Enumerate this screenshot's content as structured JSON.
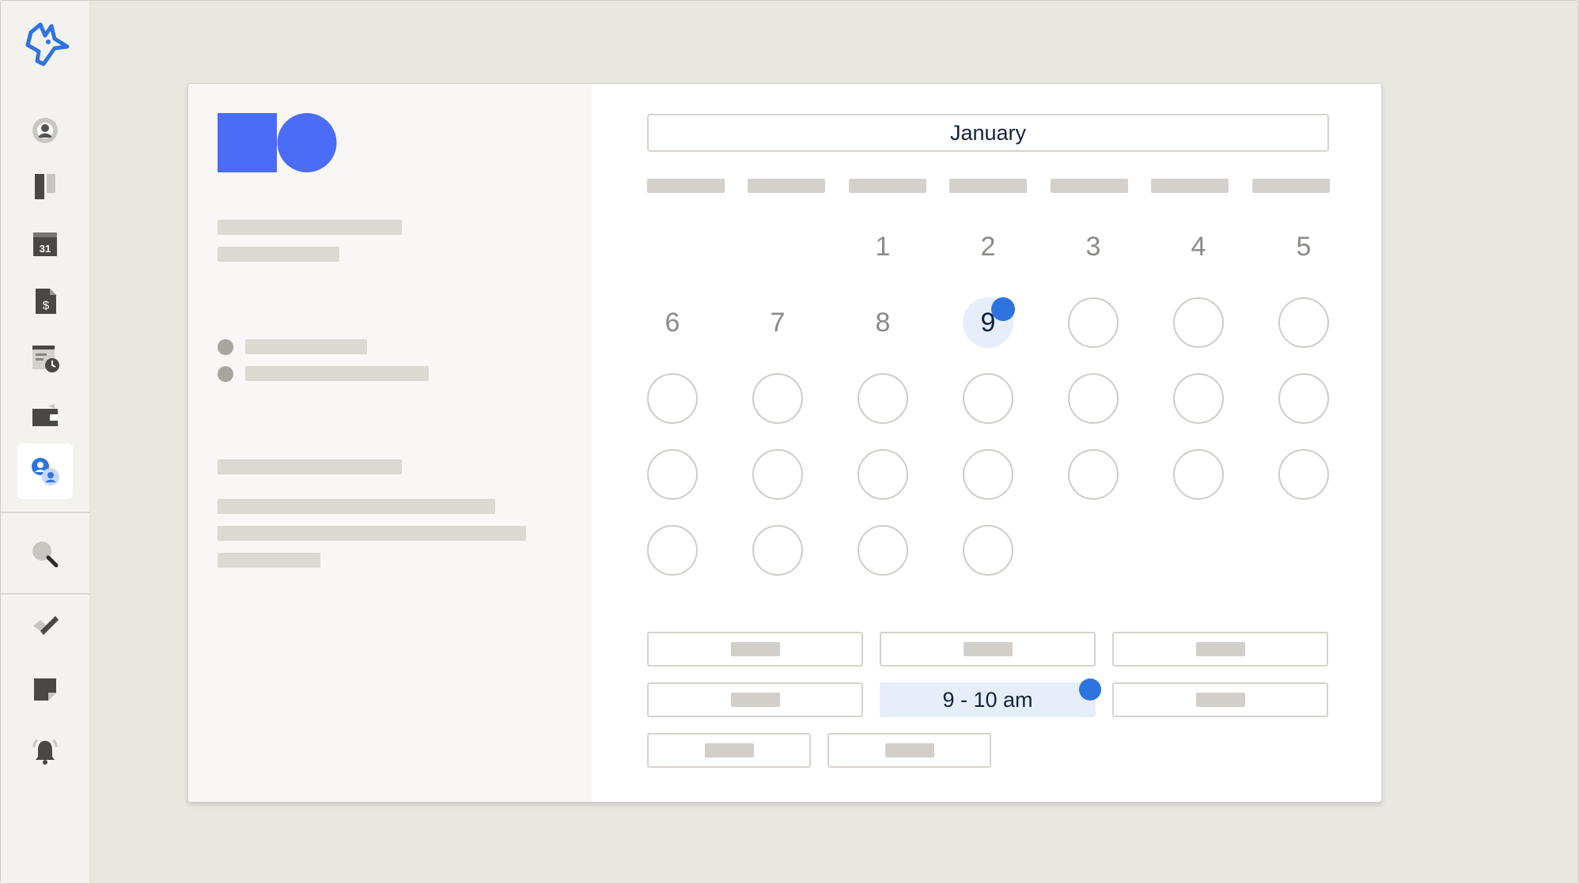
{
  "app": {
    "colors": {
      "accent": "#2d74e0",
      "brand_blue": "#4b6cf7",
      "selected_bg": "#e6eefa",
      "background": "#e8e7e0"
    }
  },
  "sidebar": {
    "logo": "bird-logo-icon",
    "items": [
      {
        "icon": "user-icon"
      },
      {
        "icon": "kanban-icon"
      },
      {
        "icon": "calendar-icon",
        "text": "31"
      },
      {
        "icon": "invoice-icon",
        "text": "$"
      },
      {
        "icon": "timesheet-icon"
      },
      {
        "icon": "wallet-icon"
      },
      {
        "icon": "scheduling-icon",
        "active": true
      },
      {
        "icon": "search-icon"
      },
      {
        "icon": "tasks-icon"
      },
      {
        "icon": "notes-icon"
      },
      {
        "icon": "notifications-icon"
      }
    ]
  },
  "calendar": {
    "month": "January",
    "days": [
      "1",
      "2",
      "3",
      "4",
      "5",
      "6",
      "7",
      "8",
      "9"
    ],
    "selected_day": "9"
  },
  "time_slots": {
    "selected": "9 - 10 am"
  }
}
